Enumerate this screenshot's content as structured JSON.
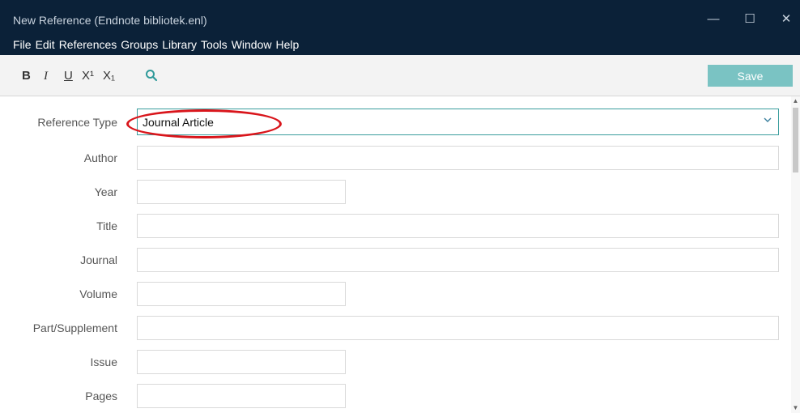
{
  "window": {
    "title": "New Reference (Endnote bibliotek.enl)",
    "minimize": "—",
    "maximize": "☐",
    "close": "✕"
  },
  "menu": [
    "File",
    "Edit",
    "References",
    "Groups",
    "Library",
    "Tools",
    "Window",
    "Help"
  ],
  "toolbar": {
    "bold": "B",
    "italic": "I",
    "underline": "U",
    "superscript": "X¹",
    "subscript": "X₁",
    "search_icon": "search-icon",
    "save_label": "Save",
    "save_color": "#7ac3c3"
  },
  "form": {
    "reference_type_label": "Reference Type",
    "reference_type_value": "Journal Article",
    "fields": [
      {
        "label": "Author",
        "value": ""
      },
      {
        "label": "Year",
        "value": ""
      },
      {
        "label": "Title",
        "value": ""
      },
      {
        "label": "Journal",
        "value": ""
      },
      {
        "label": "Volume",
        "value": ""
      },
      {
        "label": "Part/Supplement",
        "value": ""
      },
      {
        "label": "Issue",
        "value": ""
      },
      {
        "label": "Pages",
        "value": ""
      }
    ]
  },
  "colors": {
    "titlebar": "#0b2138",
    "accent": "#3a9d9d",
    "annotation": "#d9151b"
  }
}
